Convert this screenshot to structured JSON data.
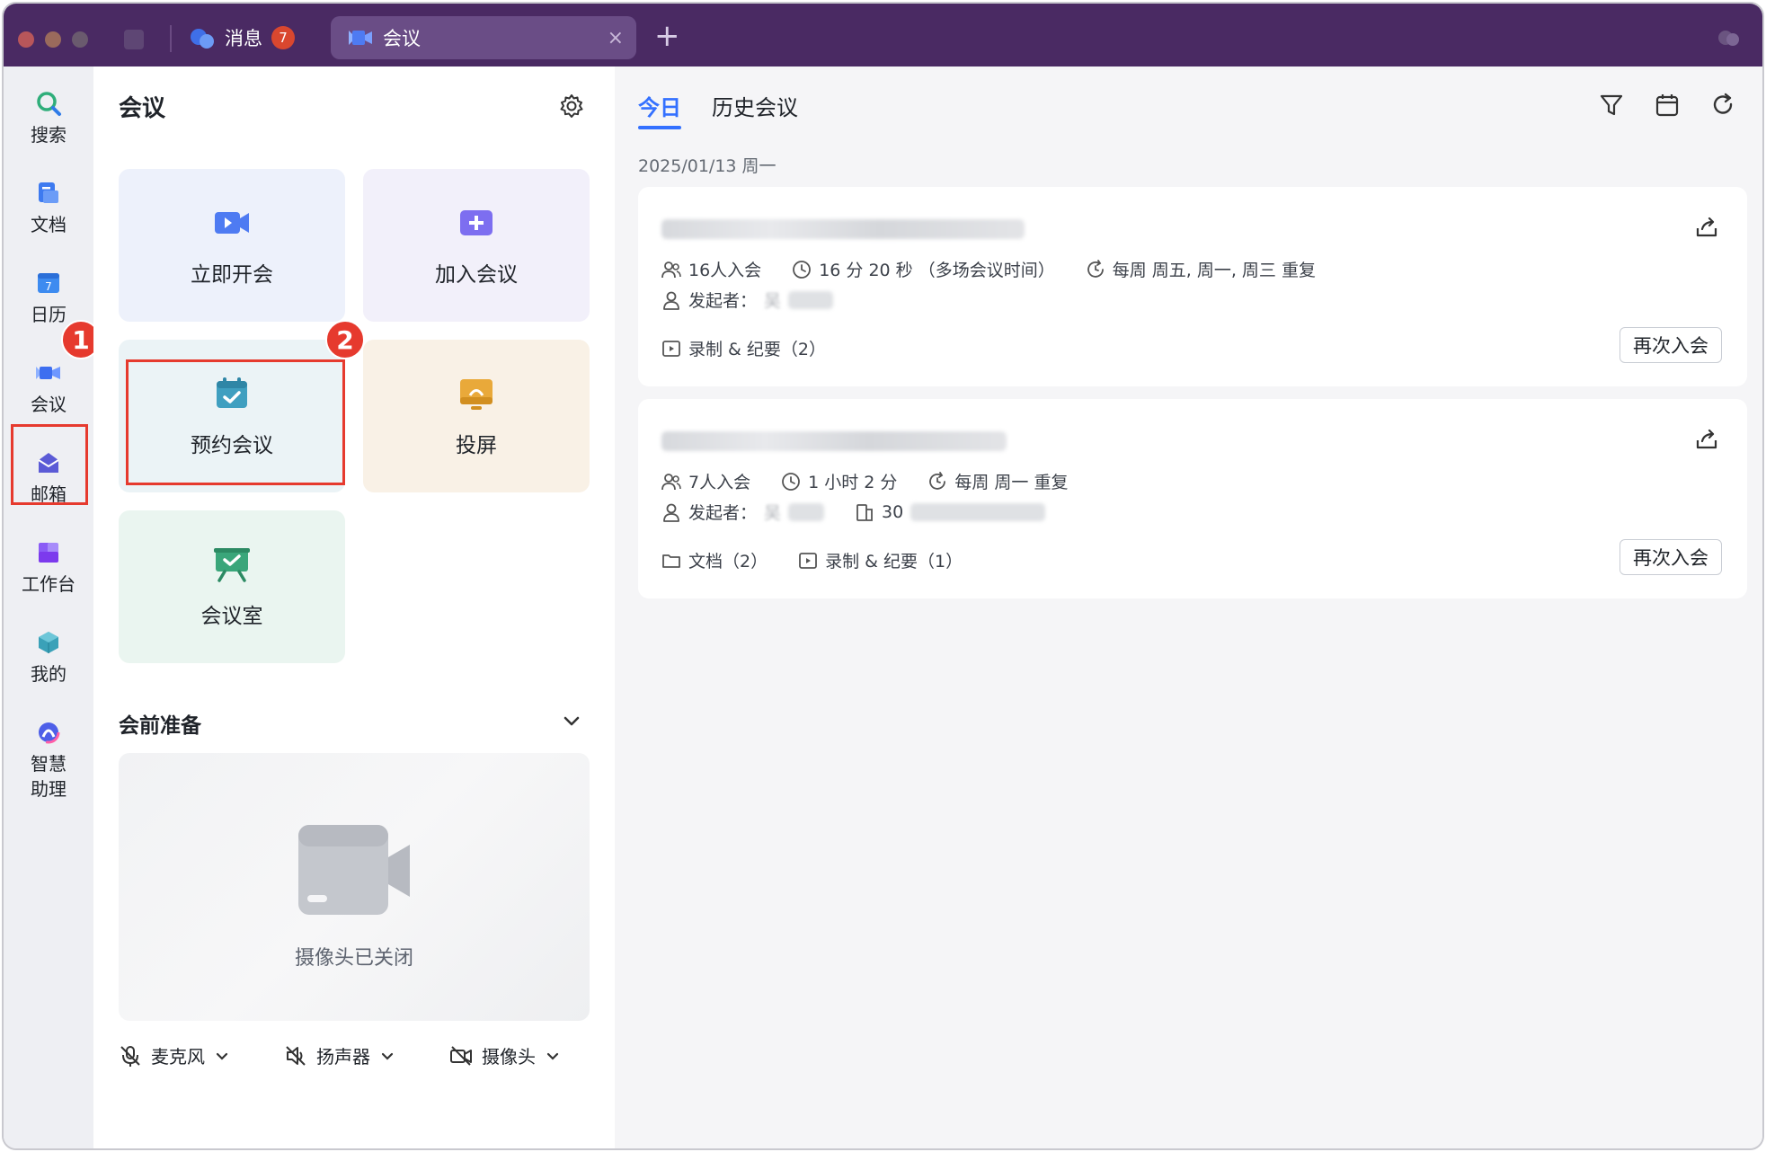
{
  "titlebar": {
    "tab_messages": {
      "label": "消息",
      "badge": "7"
    },
    "tab_meeting": {
      "label": "会议",
      "close": "×"
    },
    "new_tab": "+"
  },
  "rail": {
    "items": [
      {
        "label": "搜索",
        "icon": "search-icon"
      },
      {
        "label": "文档",
        "icon": "docs-icon"
      },
      {
        "label": "日历",
        "icon": "calendar-icon"
      },
      {
        "label": "会议",
        "icon": "meeting-icon"
      },
      {
        "label": "邮箱",
        "icon": "mail-icon"
      },
      {
        "label": "工作台",
        "icon": "workbench-icon"
      },
      {
        "label": "我的",
        "icon": "cube-icon"
      },
      {
        "label": "智慧\n助理",
        "icon": "assistant-icon"
      }
    ],
    "callout_1": "1",
    "callout_2": "2"
  },
  "meetings_panel": {
    "title": "会议",
    "cards": [
      {
        "label": "立即开会",
        "icon": "video-camera-icon",
        "color": "#4e7bf2"
      },
      {
        "label": "加入会议",
        "icon": "join-plus-icon",
        "color": "#7d6ef0"
      },
      {
        "label": "预约会议",
        "icon": "calendar-check-icon",
        "color": "#3f9fc0"
      },
      {
        "label": "投屏",
        "icon": "cast-screen-icon",
        "color": "#e9a93a"
      },
      {
        "label": "会议室",
        "icon": "meeting-room-icon",
        "color": "#3aa67a"
      }
    ],
    "prep_title": "会前准备",
    "camera_off": "摄像头已关闭",
    "devices": [
      {
        "label": "麦克风",
        "icon": "mic-off-icon"
      },
      {
        "label": "扬声器",
        "icon": "speaker-off-icon"
      },
      {
        "label": "摄像头",
        "icon": "camera-off-icon"
      }
    ]
  },
  "right": {
    "tab_today": "今日",
    "tab_history": "历史会议",
    "date": "2025/01/13 周一",
    "meetings": [
      {
        "participants": "16人入会",
        "duration": "16 分 20 秒 （多场会议时间）",
        "repeat": "每周 周五, 周一, 周三 重复",
        "organizer_label": "发起者：",
        "organizer_visible": "吴",
        "recording": "录制 & 纪要（2）",
        "rejoin": "再次入会"
      },
      {
        "participants": "7人入会",
        "duration": "1 小时 2 分",
        "repeat": "每周 周一 重复",
        "organizer_label": "发起者：",
        "organizer_visible": "吴",
        "room_prefix": "30",
        "docs": "文档（2）",
        "recording": "录制 & 纪要（1）",
        "rejoin": "再次入会"
      }
    ]
  },
  "colors": {
    "titlebar": "#4a2a63",
    "accent": "#3370ff",
    "callout": "#e63a2e"
  }
}
